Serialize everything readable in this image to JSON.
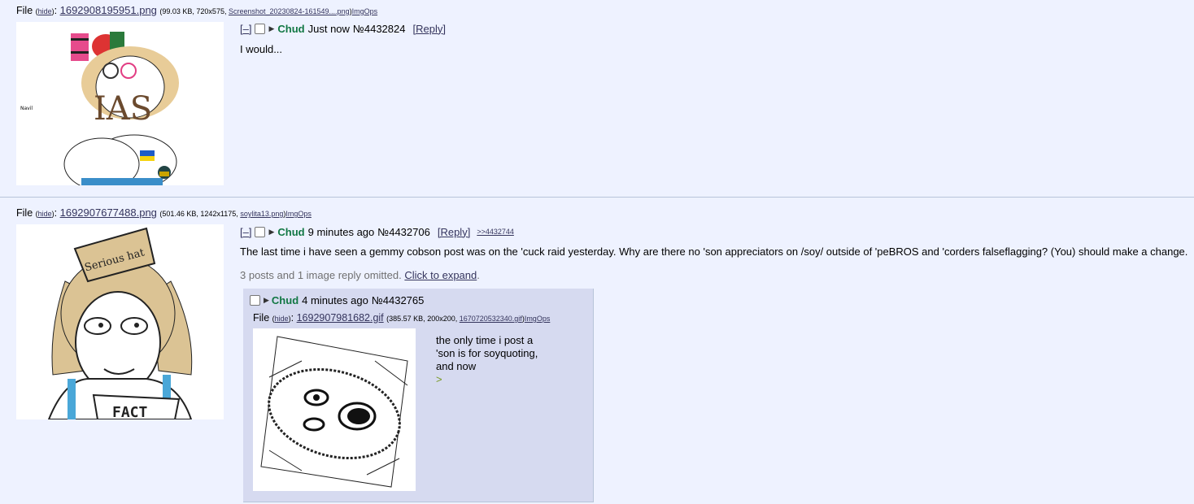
{
  "post1": {
    "file_label": "File",
    "hide_label": "hide",
    "filename": "1692908195951.png",
    "file_meta_prefix": "(99.03 KB, 720x575, ",
    "orig_name": "Screenshot_20230824-161549....png",
    "meta_close": ")",
    "imgops": "ImgOps",
    "collapse": "[–]",
    "name": "Chud",
    "time": "Just now",
    "number": "№4432824",
    "reply_link": "[Reply]",
    "body": "I would..."
  },
  "post2": {
    "file_label": "File",
    "hide_label": "hide",
    "filename": "1692907677488.png",
    "file_meta_prefix": "(501.46 KB, 1242x1175, ",
    "orig_name": "soylita13.png",
    "meta_close": ")",
    "imgops": "ImgOps",
    "collapse": "[–]",
    "name": "Chud",
    "time": "9 minutes ago",
    "number": "№4432706",
    "reply_link": "[Reply]",
    "backlink": ">>4432744",
    "body": "The last time i have seen a gemmy cobson post was on the 'cuck raid yesterday. Why are there no 'son appreciators on /soy/ outside of 'peBROS and 'corders falseflagging? (You) should make a change.",
    "omitted_text": "3 posts and 1 image reply omitted.",
    "expand_link": "Click to expand",
    "expand_suffix": ".",
    "thumb_caption_hat": "Serious hat",
    "thumb_caption_shirt": "FACT"
  },
  "reply": {
    "name": "Chud",
    "time": "4 minutes ago",
    "number": "№4432765",
    "file_label": "File",
    "hide_label": "hide",
    "filename": "1692907981682.gif",
    "file_meta_prefix": "(385.57 KB, 200x200, ",
    "orig_name": "1670720532340.gif",
    "meta_close": ")",
    "imgops": "ImgOps",
    "body_lines": [
      "the only time i post a",
      "'son is for soyquoting,",
      "and now",
      ">"
    ]
  },
  "colors": {
    "background": "#eef2ff",
    "name": "#117743",
    "link": "#34345c",
    "reply_bg": "#d6daf0",
    "greentext": "#789922"
  }
}
